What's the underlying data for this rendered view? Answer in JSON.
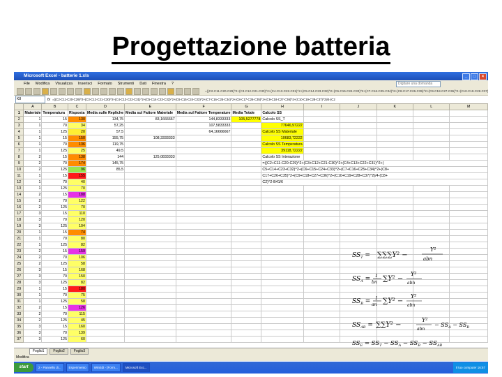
{
  "slide": {
    "title": "Progettazione batteria"
  },
  "window": {
    "title": "Microsoft Excel - batterie 1.xls"
  },
  "menu": [
    "File",
    "Modifica",
    "Visualizza",
    "Inserisci",
    "Formato",
    "Strumenti",
    "Dati",
    "Finestra",
    "?"
  ],
  "help_placeholder": "Digitare una domanda",
  "namebox": "K8",
  "formula_bar_text": "=((C2-C11-C20-C29)^2+(C3-C12-C21-C30)^2+(C4-C13-C22-C31)^2+(C5-C14-C23-C32)^2+(C6-C15-C24-C33)^2+(C7-C16-C25-C34)^2+(C8-C17-C26-C35)^2+(C9-C18-C27-C36)^2+(C10-C19-C28-C37)^2)/4-(C2",
  "toolbar_formula": "=((C2-C11-C20-C29)^2+(C3-C12-C21-C30)^2+(C4-C13-C22-C31)^2+(C5-C14-C23-C32)^2+(C6-C15-C24-C33)^2+(C7-C16-C25-C34)^2+(C8-C17-C26-C35)^2+(C9-C18-C27-C36)^2+(C10-C19-C28-C37)^2)",
  "headers": [
    "Materiale",
    "Temperatura",
    "Risposta",
    "Media sulle Repliche",
    "Media sul Fattore Materiale",
    "Media sul Fattore Temperature",
    "Media Totale",
    "Calcolo SS"
  ],
  "mat": [
    1,
    1,
    1,
    1,
    1,
    1,
    2,
    2,
    2,
    1,
    1,
    1,
    2,
    2,
    2,
    3,
    3,
    3,
    1,
    1,
    1,
    2,
    2,
    2,
    3,
    3,
    3,
    1,
    1,
    1,
    2,
    2,
    2,
    3,
    3,
    3
  ],
  "temp": [
    15,
    70,
    125,
    15,
    70,
    125,
    15,
    70,
    125,
    15,
    70,
    125,
    15,
    70,
    125,
    15,
    70,
    125,
    15,
    70,
    125,
    15,
    70,
    125,
    15,
    70,
    125,
    15,
    70,
    125,
    15,
    70,
    125,
    15,
    70,
    125
  ],
  "resp": [
    130,
    34,
    20,
    150,
    136,
    25,
    138,
    174,
    96,
    155,
    40,
    70,
    188,
    122,
    70,
    110,
    120,
    104,
    74,
    80,
    82,
    159,
    106,
    58,
    168,
    150,
    82,
    180,
    75,
    58,
    126,
    115,
    45,
    160,
    139,
    60
  ],
  "resp_colors": [
    "orn",
    "ys",
    "yel2",
    "orn",
    "orn",
    "ys",
    "orn",
    "orn",
    "grn",
    "red",
    "ys",
    "ys",
    "mag",
    "ys",
    "ys",
    "ys",
    "ys",
    "ys",
    "orn",
    "ys",
    "ys",
    "mag",
    "ys",
    "ys",
    "ys",
    "ys",
    "ys",
    "red",
    "ys",
    "ys",
    "mag",
    "ys",
    "ys",
    "ys",
    "ys",
    "ys"
  ],
  "media_repliche": [
    "134,75",
    "57,25",
    "57,5",
    "155,75",
    "119,75",
    "49,5",
    "144",
    "145,75",
    "85,5"
  ],
  "media_materiale": [
    "83,1666667",
    "",
    "",
    "108,3333333",
    "",
    "",
    "125,0833333",
    "",
    ""
  ],
  "media_temperatura": [
    "144,8333333",
    "107,5833333",
    "64,16666667"
  ],
  "media_totale": "105,5277778",
  "calcolo_ss": {
    "ss_t_label": "Calcolo SS_T",
    "ss_t_value": "77646,97222",
    "ss_a_label": "Calcolo SS Materiale",
    "ss_a_value": "10683,72222",
    "ss_b_label": "Calcolo SS Temperatura",
    "ss_b_value": "39118,72222",
    "ss_ab_label": "Calcolo SS Interazione",
    "ss_ab_formula_1": "=((C2+C11-C20-C29)^2+(C3+C12+C21-C30)^2+(C4+C13+C22+C31)^2+(",
    "ss_ab_formula_2": "C5+C14+C23+C32)^2+(C6+C15+C24+C33)^2+(C7+C16+C25+C34)^2+(C8+",
    "ss_ab_formula_3": "C17+C26+C35)^2+(C9+C18+C27+C36)^2+(C10+C19+C28+C37)^2)/4-(C8+",
    "ss_ab_formula_4": "C2)^2-B41/6"
  },
  "sheets": [
    "Foglio1",
    "Foglio2",
    "Foglio3"
  ],
  "status": "Modifica",
  "taskbar": {
    "start": "start",
    "tasks": [
      "2 - Pannello di...",
      "Esperimento",
      "WinEdt - [Form...",
      "Microsoft Exc..."
    ],
    "tray": "Il tuo computer  16:57"
  },
  "math_labels": {
    "sst": "SS_T",
    "ssa": "SS_A",
    "ssb": "SS_B",
    "ssab": "SS_AB",
    "sse": "SS_E"
  }
}
